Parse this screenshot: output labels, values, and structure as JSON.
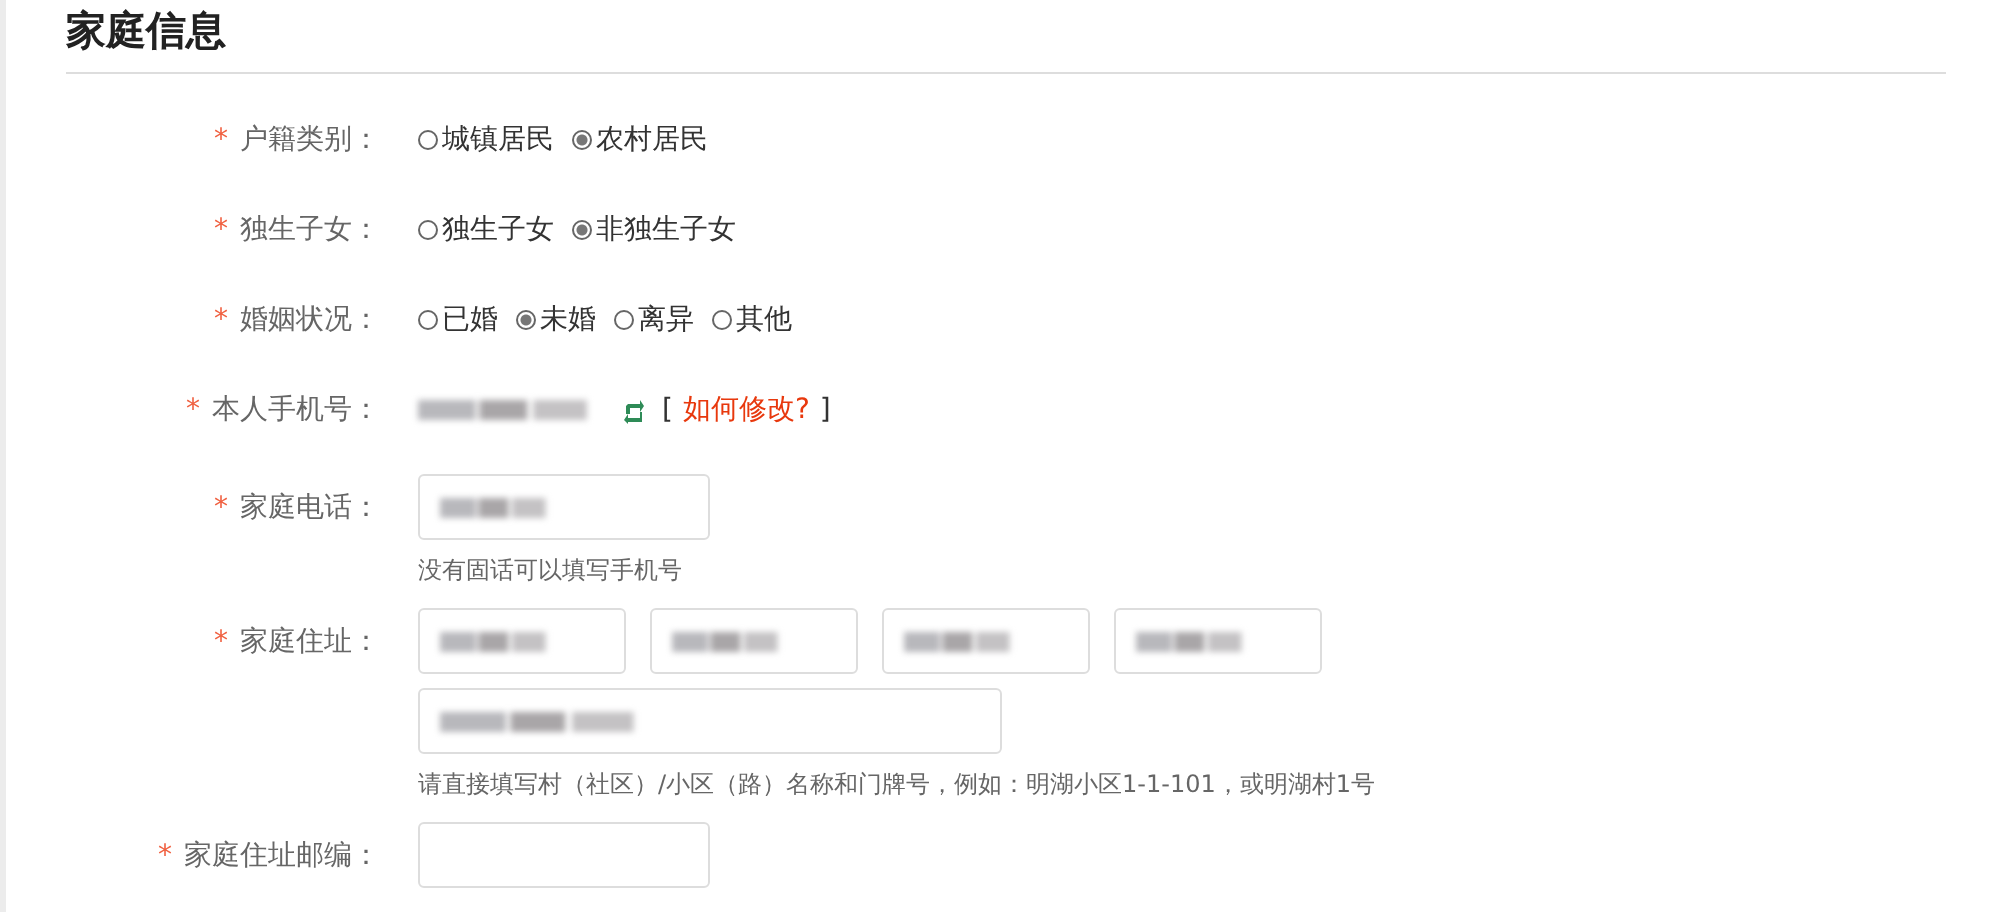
{
  "section_title": "家庭信息",
  "rows": [
    {
      "kind": "radio",
      "mark": "*",
      "label": "户籍类别：",
      "options": [
        {
          "label": "城镇居民",
          "selected": false
        },
        {
          "label": "农村居民",
          "selected": true
        }
      ]
    },
    {
      "kind": "radio",
      "mark": "*",
      "label": "独生子女：",
      "options": [
        {
          "label": "独生子女",
          "selected": false
        },
        {
          "label": "非独生子女",
          "selected": true
        }
      ]
    },
    {
      "kind": "radio",
      "mark": "*",
      "label": "婚姻状况：",
      "options": [
        {
          "label": "已婚",
          "selected": false
        },
        {
          "label": "未婚",
          "selected": true
        },
        {
          "label": "离异",
          "selected": false
        },
        {
          "label": "其他",
          "selected": false
        }
      ]
    },
    {
      "kind": "phone",
      "mark": "*",
      "label": "本人手机号：",
      "bracket_open": "[",
      "link": "如何修改?",
      "bracket_close": "]"
    },
    {
      "kind": "input",
      "mark": "*",
      "label": "家庭电话：",
      "fields": [
        {
          "redacted": true
        }
      ],
      "hint": "没有固话可以填写手机号"
    },
    {
      "kind": "address",
      "mark": "*",
      "label": "家庭住址：",
      "fields": [
        {
          "redacted": true
        },
        {
          "redacted": true
        },
        {
          "redacted": true
        },
        {
          "redacted": true
        }
      ],
      "detail": {
        "redacted": true
      },
      "hint": "请直接填写村（社区）/小区（路）名称和门牌号，例如：明湖小区1-1-101，或明湖村1号"
    },
    {
      "kind": "input",
      "mark": "*",
      "label": "家庭住址邮编：",
      "fields": [
        {
          "redacted": false
        }
      ]
    }
  ]
}
